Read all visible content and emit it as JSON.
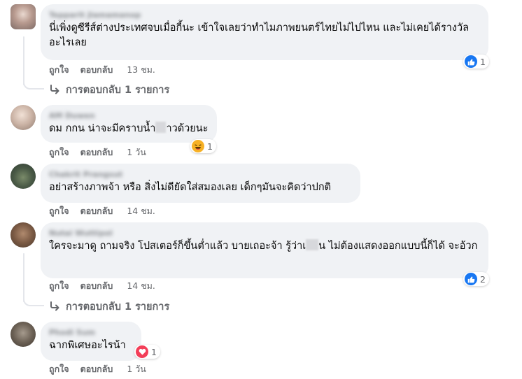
{
  "comments": [
    {
      "author": "Tepparit Jiamamanop",
      "text_a": "นี่เพิ่งดูซีรีส์ต่างประเทศจบเมื่อกี้นะ เข้าใจเลยว่าทำไมภาพยนตร์ไทยไม่ไปไหน และไม่เคยได้รางวัลอะไรเลย",
      "text_b": "",
      "like_label": "ถูกใจ",
      "reply_label": "ตอบกลับ",
      "time": "13 ชม.",
      "reaction": {
        "type": "like",
        "count": "1"
      },
      "replies_label": "การตอบกลับ 1 รายการ"
    },
    {
      "author": "AM Duwen",
      "text_a": "ดม กกน น่าจะมีคราบน้ำ",
      "text_b": "าวด้วยนะ",
      "like_label": "ถูกใจ",
      "reply_label": "ตอบกลับ",
      "time": "1 วัน",
      "reaction": {
        "type": "haha",
        "count": "1"
      }
    },
    {
      "author": "Chakrit Prangsut",
      "text_a": "อย่าสร้างภาพจ้า หรือ สิ่งไม่ดียัดใส่สมองเลย เด็กๆมันจะคิดว่าปกติ",
      "text_b": "",
      "like_label": "ถูกใจ",
      "reply_label": "ตอบกลับ",
      "time": "14 ชม."
    },
    {
      "author": "Nutai Wuttipol",
      "text_a": "ใครจะมาดู ถามจริง โปสเตอร์ก็ขึ้นต่ำแล้ว บายเถอะจ้า รู้ว่าเ",
      "text_b": "น ไม่ต้องแสดงออกแบบนี้ก็ได้ จะอ้วก",
      "like_label": "ถูกใจ",
      "reply_label": "ตอบกลับ",
      "time": "14 ชม.",
      "reaction": {
        "type": "like",
        "count": "2"
      },
      "replies_label": "การตอบกลับ 1 รายการ"
    },
    {
      "author": "Phodi Sum",
      "text_a": "ฉากพิเศษอะไรน้า",
      "text_b": "",
      "like_label": "ถูกใจ",
      "reply_label": "ตอบกลับ",
      "time": "1 วัน",
      "reaction": {
        "type": "love",
        "count": "1"
      }
    }
  ],
  "colors": {
    "bubble": "#f0f2f5",
    "like_blue": "#1877f2",
    "love_red": "#f33e58",
    "haha_yellow": "#f7b125",
    "meta_gray": "#65676b"
  },
  "icons": {
    "like": "thumbs-up-icon",
    "haha": "laughing-face-icon",
    "love": "heart-icon",
    "reply_arrow": "reply-arrow-icon"
  }
}
